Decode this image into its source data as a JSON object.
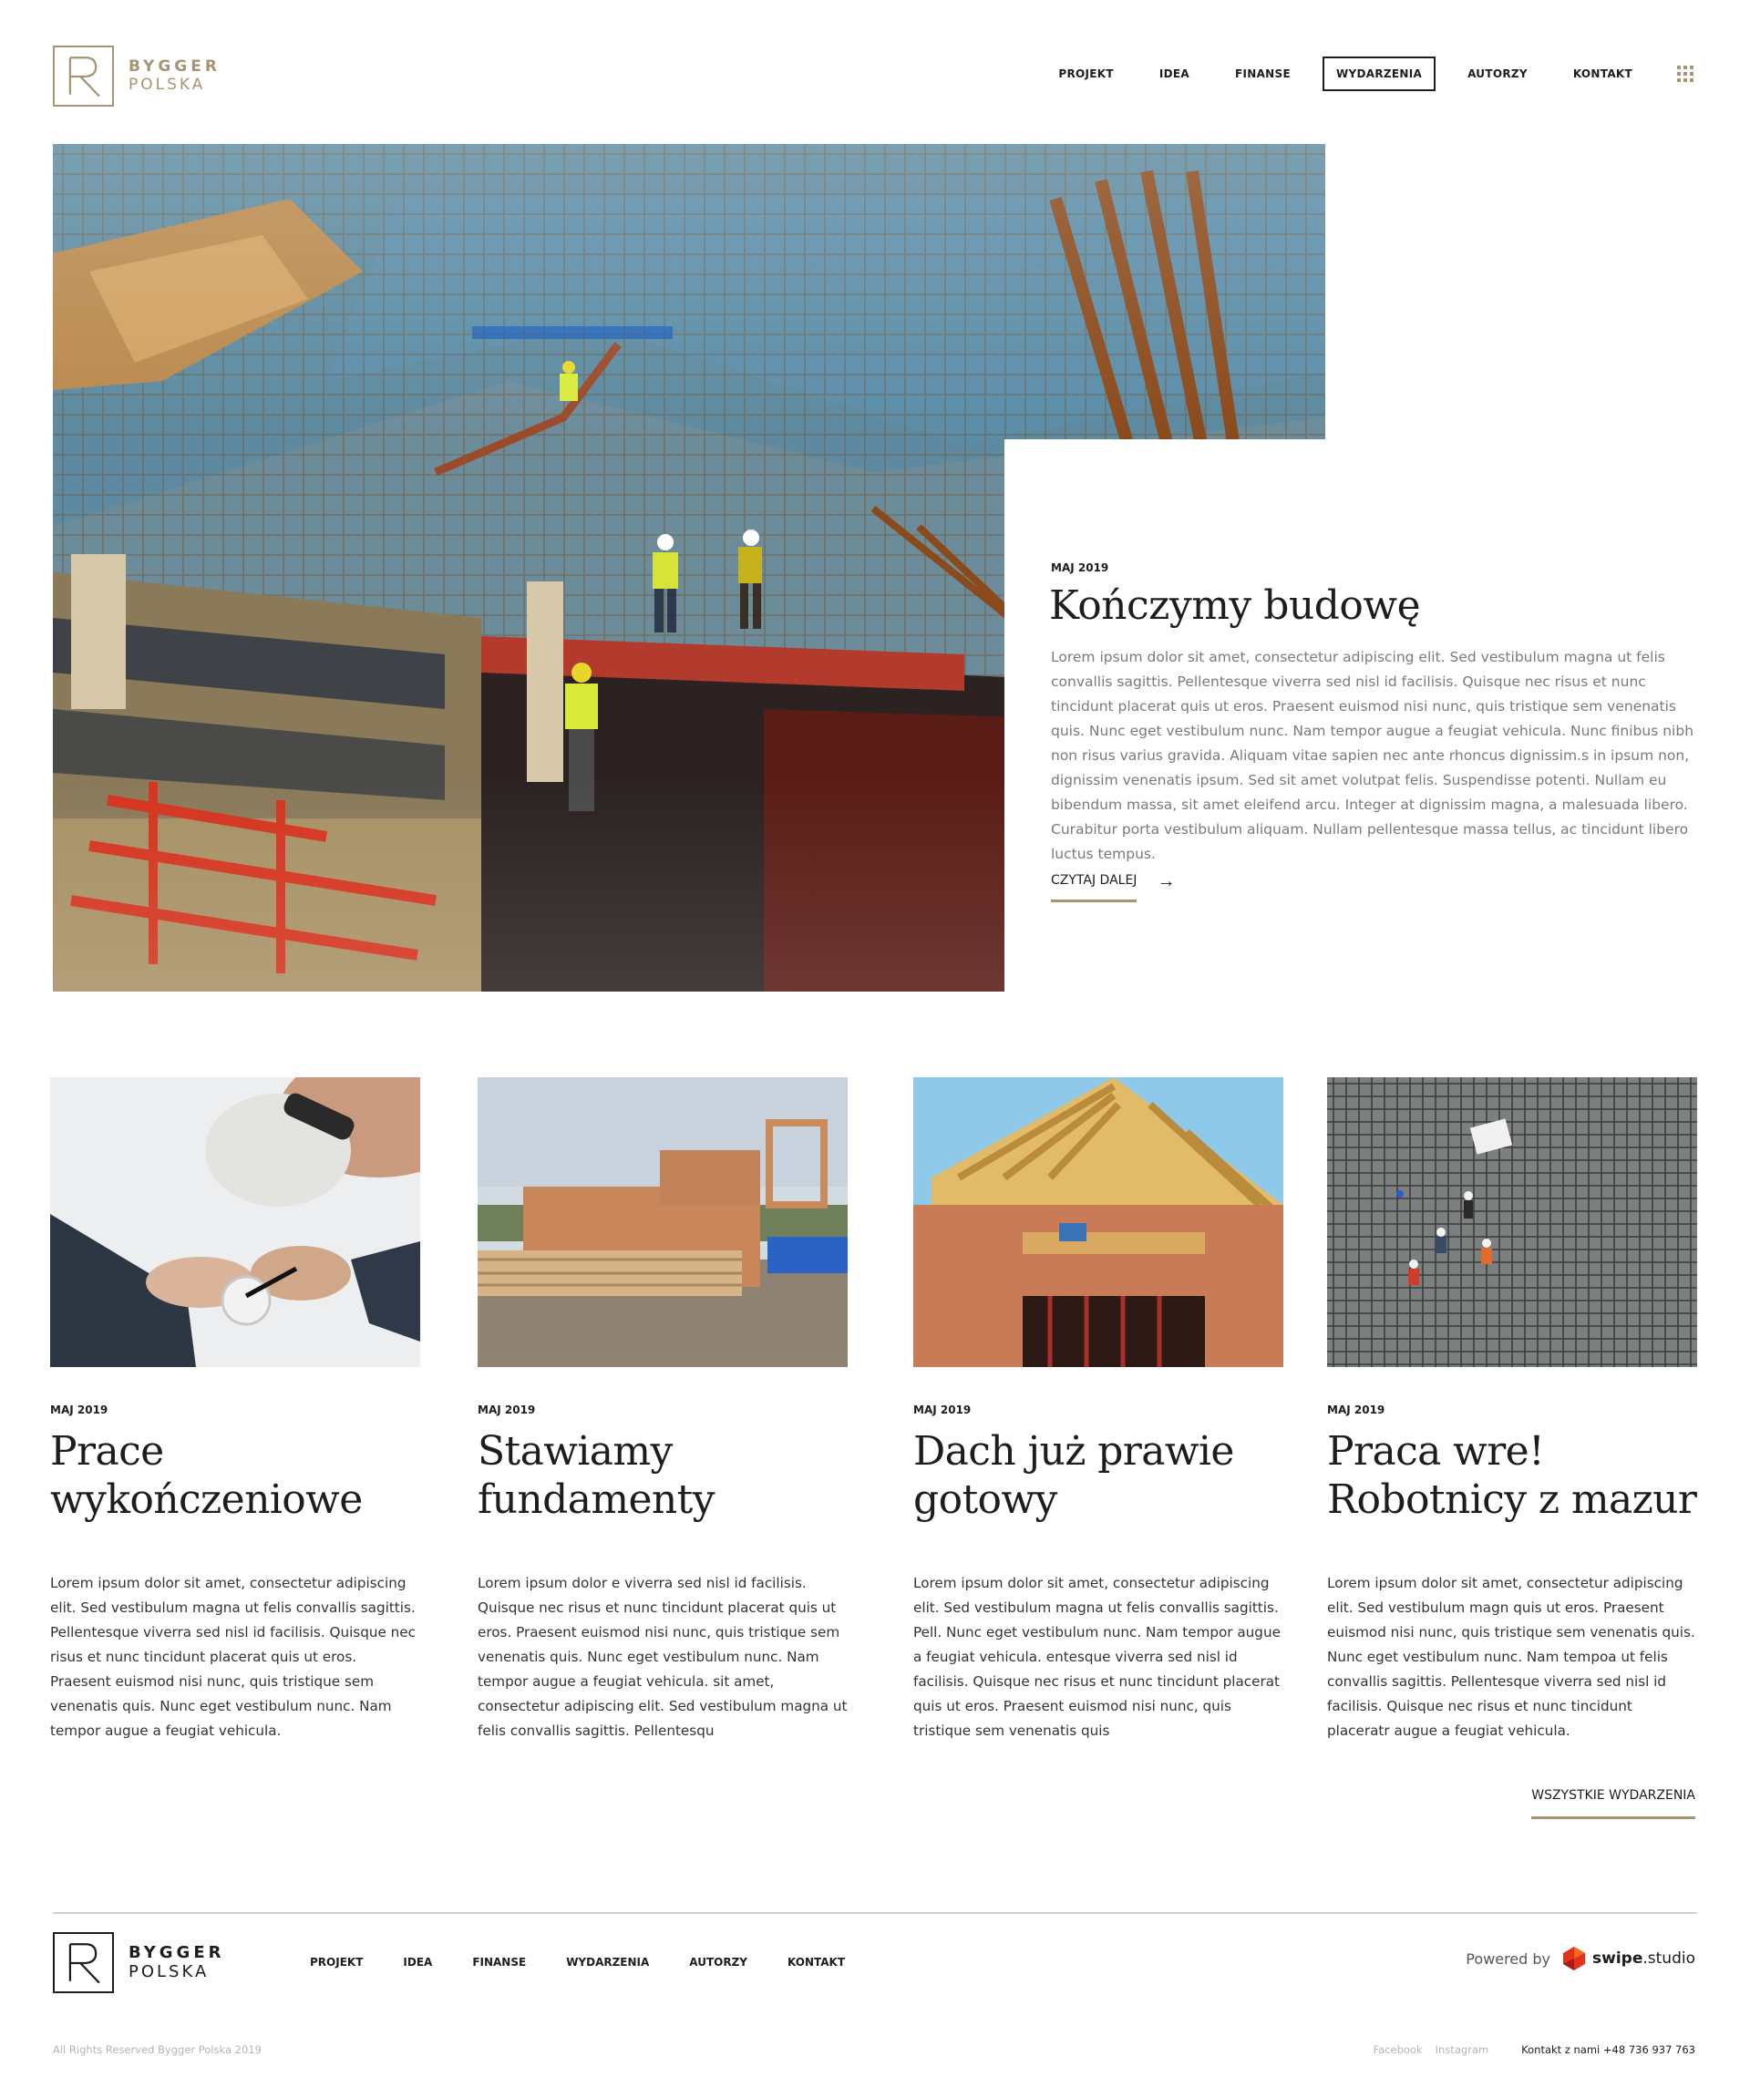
{
  "brand": {
    "line1": "BYGGER",
    "line2": "POLSKA",
    "accent_color": "#a69473"
  },
  "nav": {
    "items": [
      {
        "label": "PROJEKT"
      },
      {
        "label": "IDEA"
      },
      {
        "label": "FINANSE"
      },
      {
        "label": "WYDARZENIA",
        "active": true
      },
      {
        "label": "AUTORZY"
      },
      {
        "label": "KONTAKT"
      }
    ],
    "menu_icon": "grid-icon"
  },
  "hero": {
    "image": "construction-site-photo",
    "date": "MAJ 2019",
    "title": "Kończymy budowę",
    "body": "Lorem ipsum dolor sit amet, consectetur adipiscing elit. Sed vestibulum magna ut felis convallis sagittis. Pellentesque viverra sed nisl id facilisis. Quisque nec risus et nunc tincidunt placerat quis ut eros. Praesent euismod nisi nunc, quis tristique sem venenatis quis. Nunc eget vestibulum nunc. Nam tempor augue a feugiat vehicula. Nunc finibus nibh non risus varius gravida. Aliquam vitae sapien nec ante rhoncus dignissim.s in ipsum non, dignissim venenatis ipsum. Sed sit amet volutpat felis. Suspendisse potenti. Nullam eu bibendum massa, sit amet eleifend arcu. Integer at dignissim magna, a malesuada libero. Curabitur porta vestibulum aliquam. Nullam pellentesque massa tellus, ac tincidunt libero luctus tempus.",
    "cta": "CZYTAJ DALEJ",
    "cta_icon": "arrow-right-icon"
  },
  "events": [
    {
      "image": "electrician-photo",
      "date": "MAJ 2019",
      "title_line1": "Prace",
      "title_line2": "wykończeniowe",
      "body": "Lorem ipsum dolor sit amet, consectetur adipiscing elit. Sed vestibulum magna ut felis convallis sagittis. Pellentesque viverra sed nisl id facilisis. Quisque nec risus et nunc tincidunt placerat quis ut eros. Praesent euismod nisi nunc, quis tristique sem venenatis quis. Nunc eget vestibulum nunc. Nam tempor augue a feugiat vehicula."
    },
    {
      "image": "timber-frame-photo",
      "date": "MAJ 2019",
      "title_line1": "Stawiamy",
      "title_line2": "fundamenty",
      "body": "Lorem ipsum dolor e viverra sed nisl id facilisis. Quisque nec risus et nunc tincidunt placerat quis ut eros. Praesent euismod nisi nunc, quis tristique sem venenatis quis. Nunc eget vestibulum nunc. Nam tempor augue a feugiat vehicula. sit amet, consectetur adipiscing elit. Sed vestibulum magna ut felis convallis sagittis. Pellentesqu"
    },
    {
      "image": "roof-construction-photo",
      "date": "MAJ 2019",
      "title_line1": "Dach już prawie",
      "title_line2": "gotowy",
      "body": "Lorem ipsum dolor sit amet, consectetur adipiscing elit. Sed vestibulum magna ut felis convallis sagittis. Pell. Nunc eget vestibulum nunc. Nam tempor augue a feugiat vehicula. entesque viverra sed nisl id facilisis. Quisque nec risus et nunc tincidunt placerat quis ut eros. Praesent euismod nisi nunc, quis tristique sem venenatis quis"
    },
    {
      "image": "rebar-workers-photo",
      "date": "MAJ 2019",
      "title_line1": "Praca wre!",
      "title_line2": "Robotnicy z mazur",
      "body": "Lorem ipsum dolor sit amet, consectetur adipiscing elit. Sed vestibulum magn quis ut eros. Praesent euismod nisi nunc, quis tristique sem venenatis quis. Nunc eget vestibulum nunc. Nam tempoa ut felis convallis sagittis. Pellentesque viverra sed nisl id facilisis. Quisque nec risus et nunc tincidunt placeratr augue a feugiat vehicula."
    }
  ],
  "all_events": "WSZYSTKIE WYDARZENIA",
  "footer": {
    "nav": [
      "PROJEKT",
      "IDEA",
      "FINANSE",
      "WYDARZENIA",
      "AUTORZY",
      "KONTAKT"
    ],
    "powered_by": "Powered by",
    "studio_bold": "swipe",
    "studio_rest": ".studio",
    "copyright": "All Rights Reserved Bygger Polska 2019",
    "social": [
      "Facebook",
      "Instagram"
    ],
    "contact": "Kontakt z nami +48 736 937 763"
  }
}
